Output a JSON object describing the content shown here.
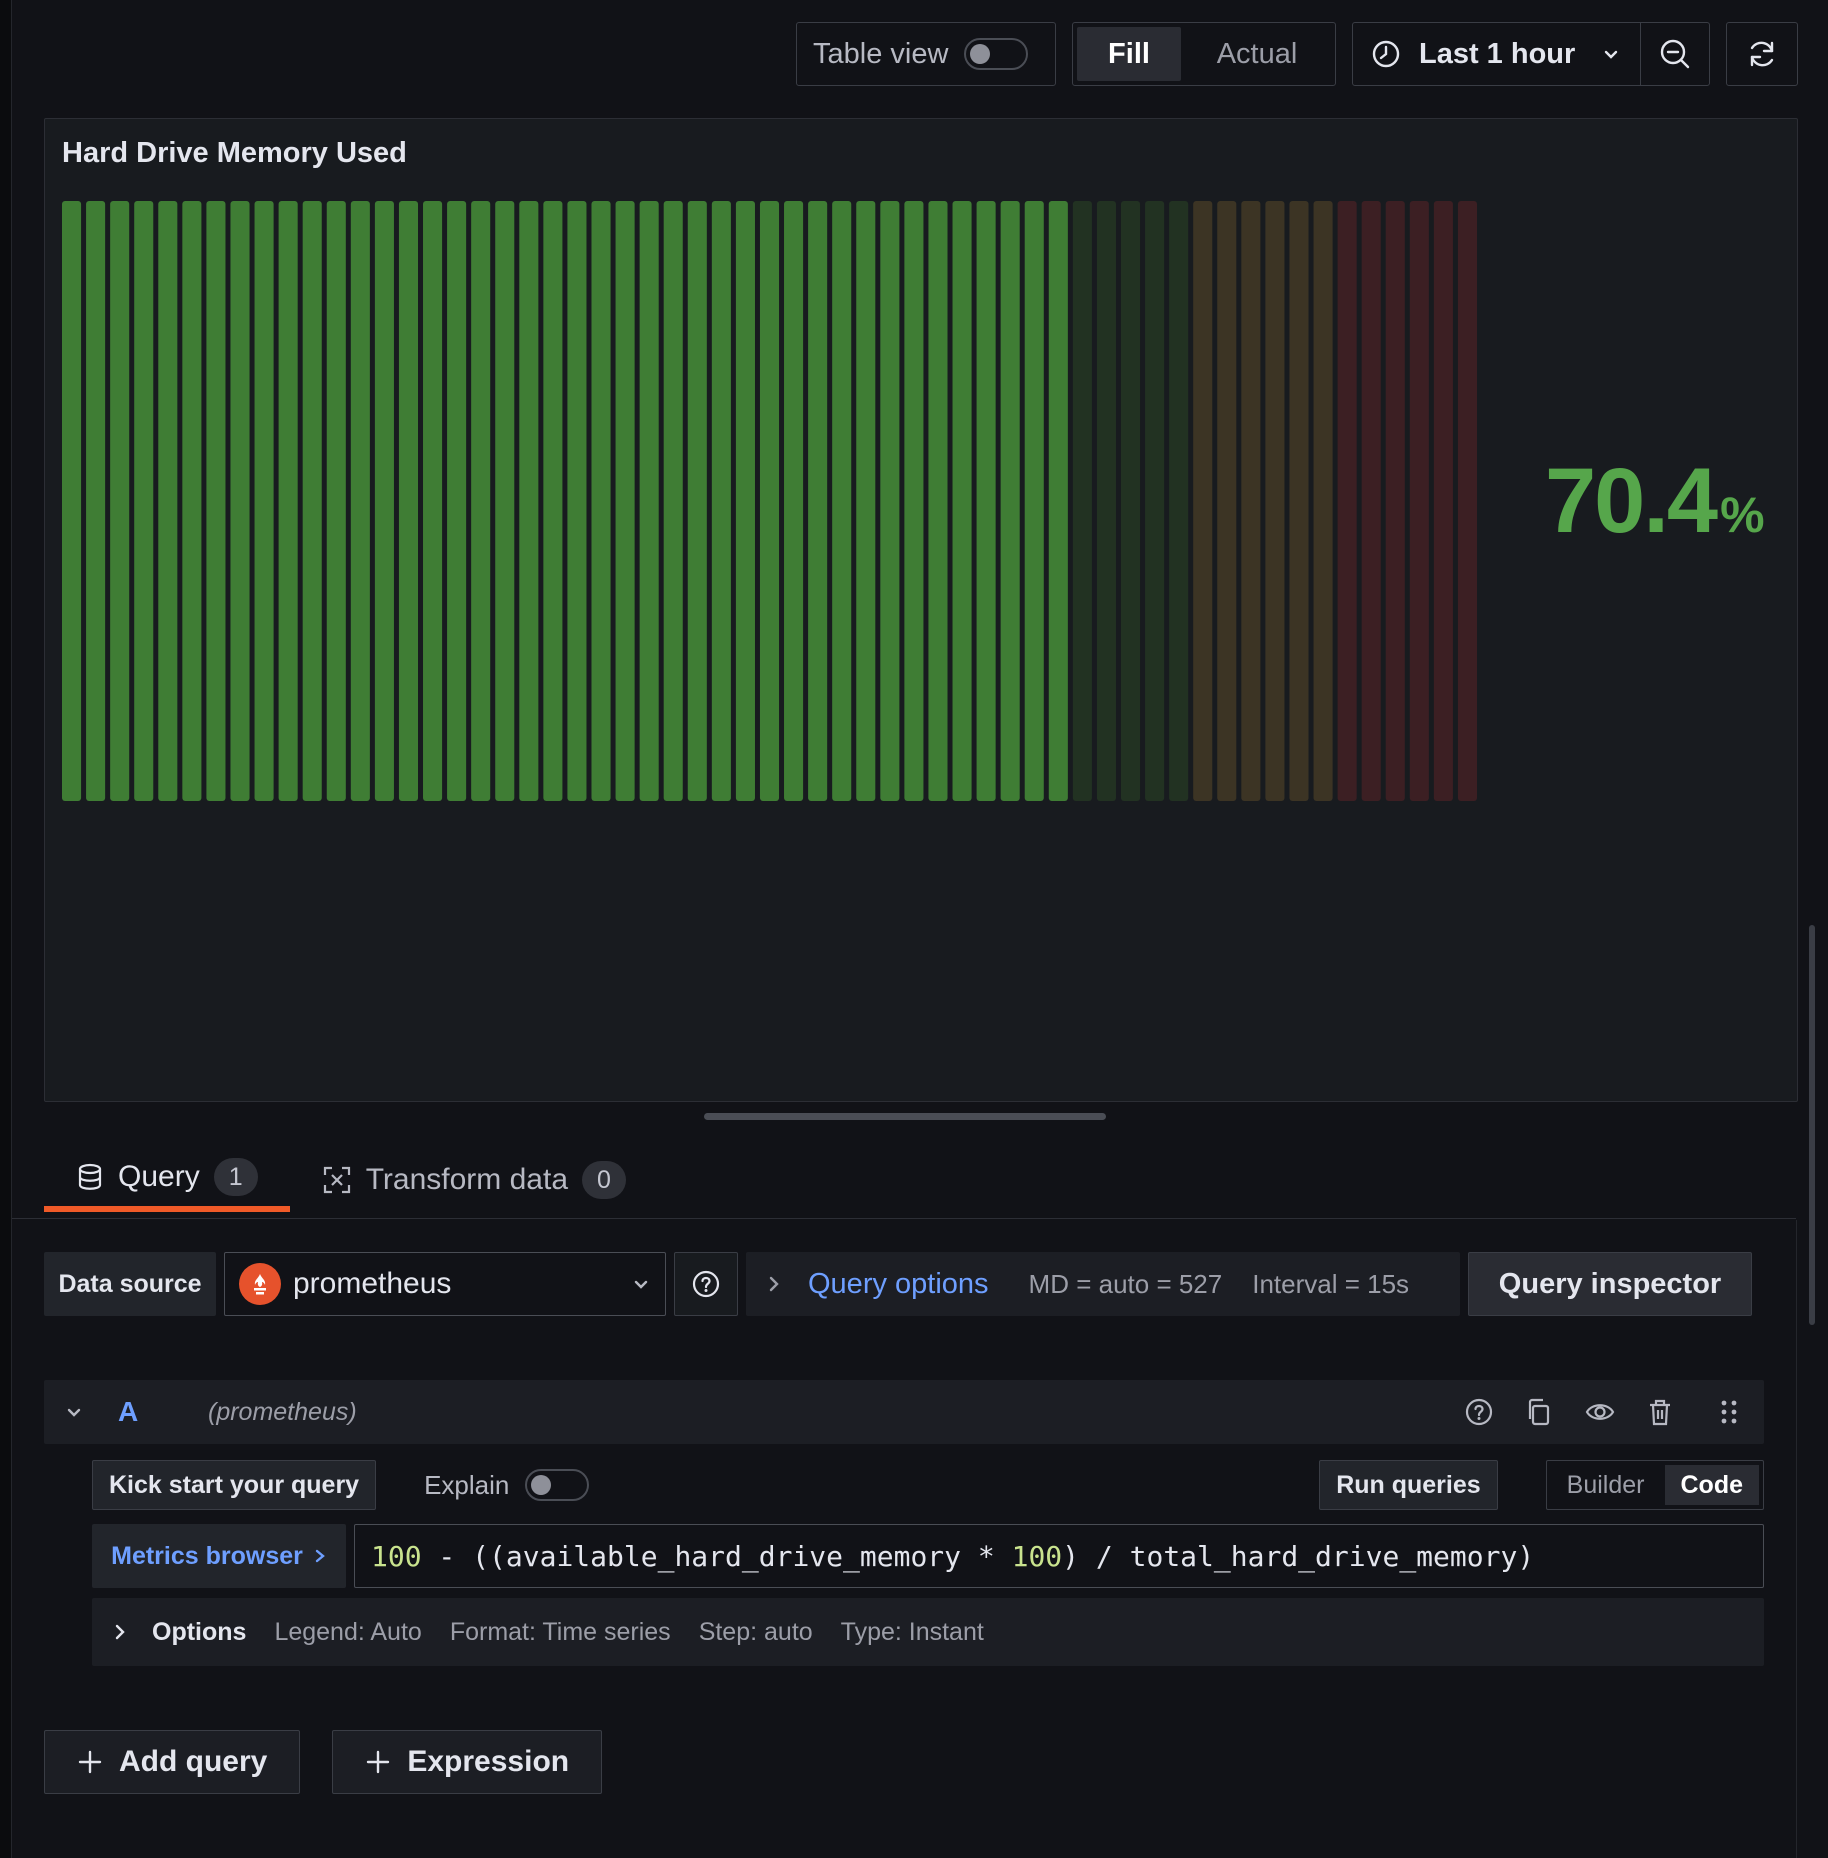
{
  "toolbar": {
    "table_view_label": "Table view",
    "table_view_on": false,
    "fill_label": "Fill",
    "actual_label": "Actual",
    "time_range": "Last 1 hour"
  },
  "panel": {
    "title": "Hard Drive Memory Used",
    "value": "70.4",
    "unit": "%",
    "colors": {
      "value": "#56a64b",
      "green": "#3f7d34",
      "green_dim": "#223222",
      "yellow": "#3c3424",
      "red": "#3c1f23"
    }
  },
  "chart_data": {
    "type": "bar",
    "kind": "bar-gauge-segments",
    "value": 70.4,
    "unit": "%",
    "segments": 59,
    "lit_segments": 42,
    "thresholds": [
      {
        "color": "green",
        "segments": 47
      },
      {
        "color": "yellow",
        "segments": 6
      },
      {
        "color": "red",
        "segments": 6
      }
    ]
  },
  "tabs": [
    {
      "label": "Query",
      "count": "1",
      "active": true
    },
    {
      "label": "Transform data",
      "count": "0",
      "active": false
    }
  ],
  "datasource": {
    "label": "Data source",
    "value": "prometheus",
    "query_options_label": "Query options",
    "md": "MD = auto = 527",
    "interval": "Interval = 15s",
    "inspector_label": "Query inspector"
  },
  "query": {
    "letter": "A",
    "ds_name": "(prometheus)",
    "kick_start": "Kick start your query",
    "explain_label": "Explain",
    "run_label": "Run queries",
    "builder_label": "Builder",
    "code_label": "Code",
    "metrics_browser": "Metrics browser",
    "expr_parts": [
      "100",
      " - ((available_hard_drive_memory * ",
      "100",
      ") / total_hard_drive_memory)"
    ],
    "options_label": "Options",
    "legend": "Legend: Auto",
    "format": "Format: Time series",
    "step": "Step: auto",
    "type": "Type: Instant"
  },
  "actions": {
    "add_query": "Add query",
    "expression": "Expression"
  }
}
